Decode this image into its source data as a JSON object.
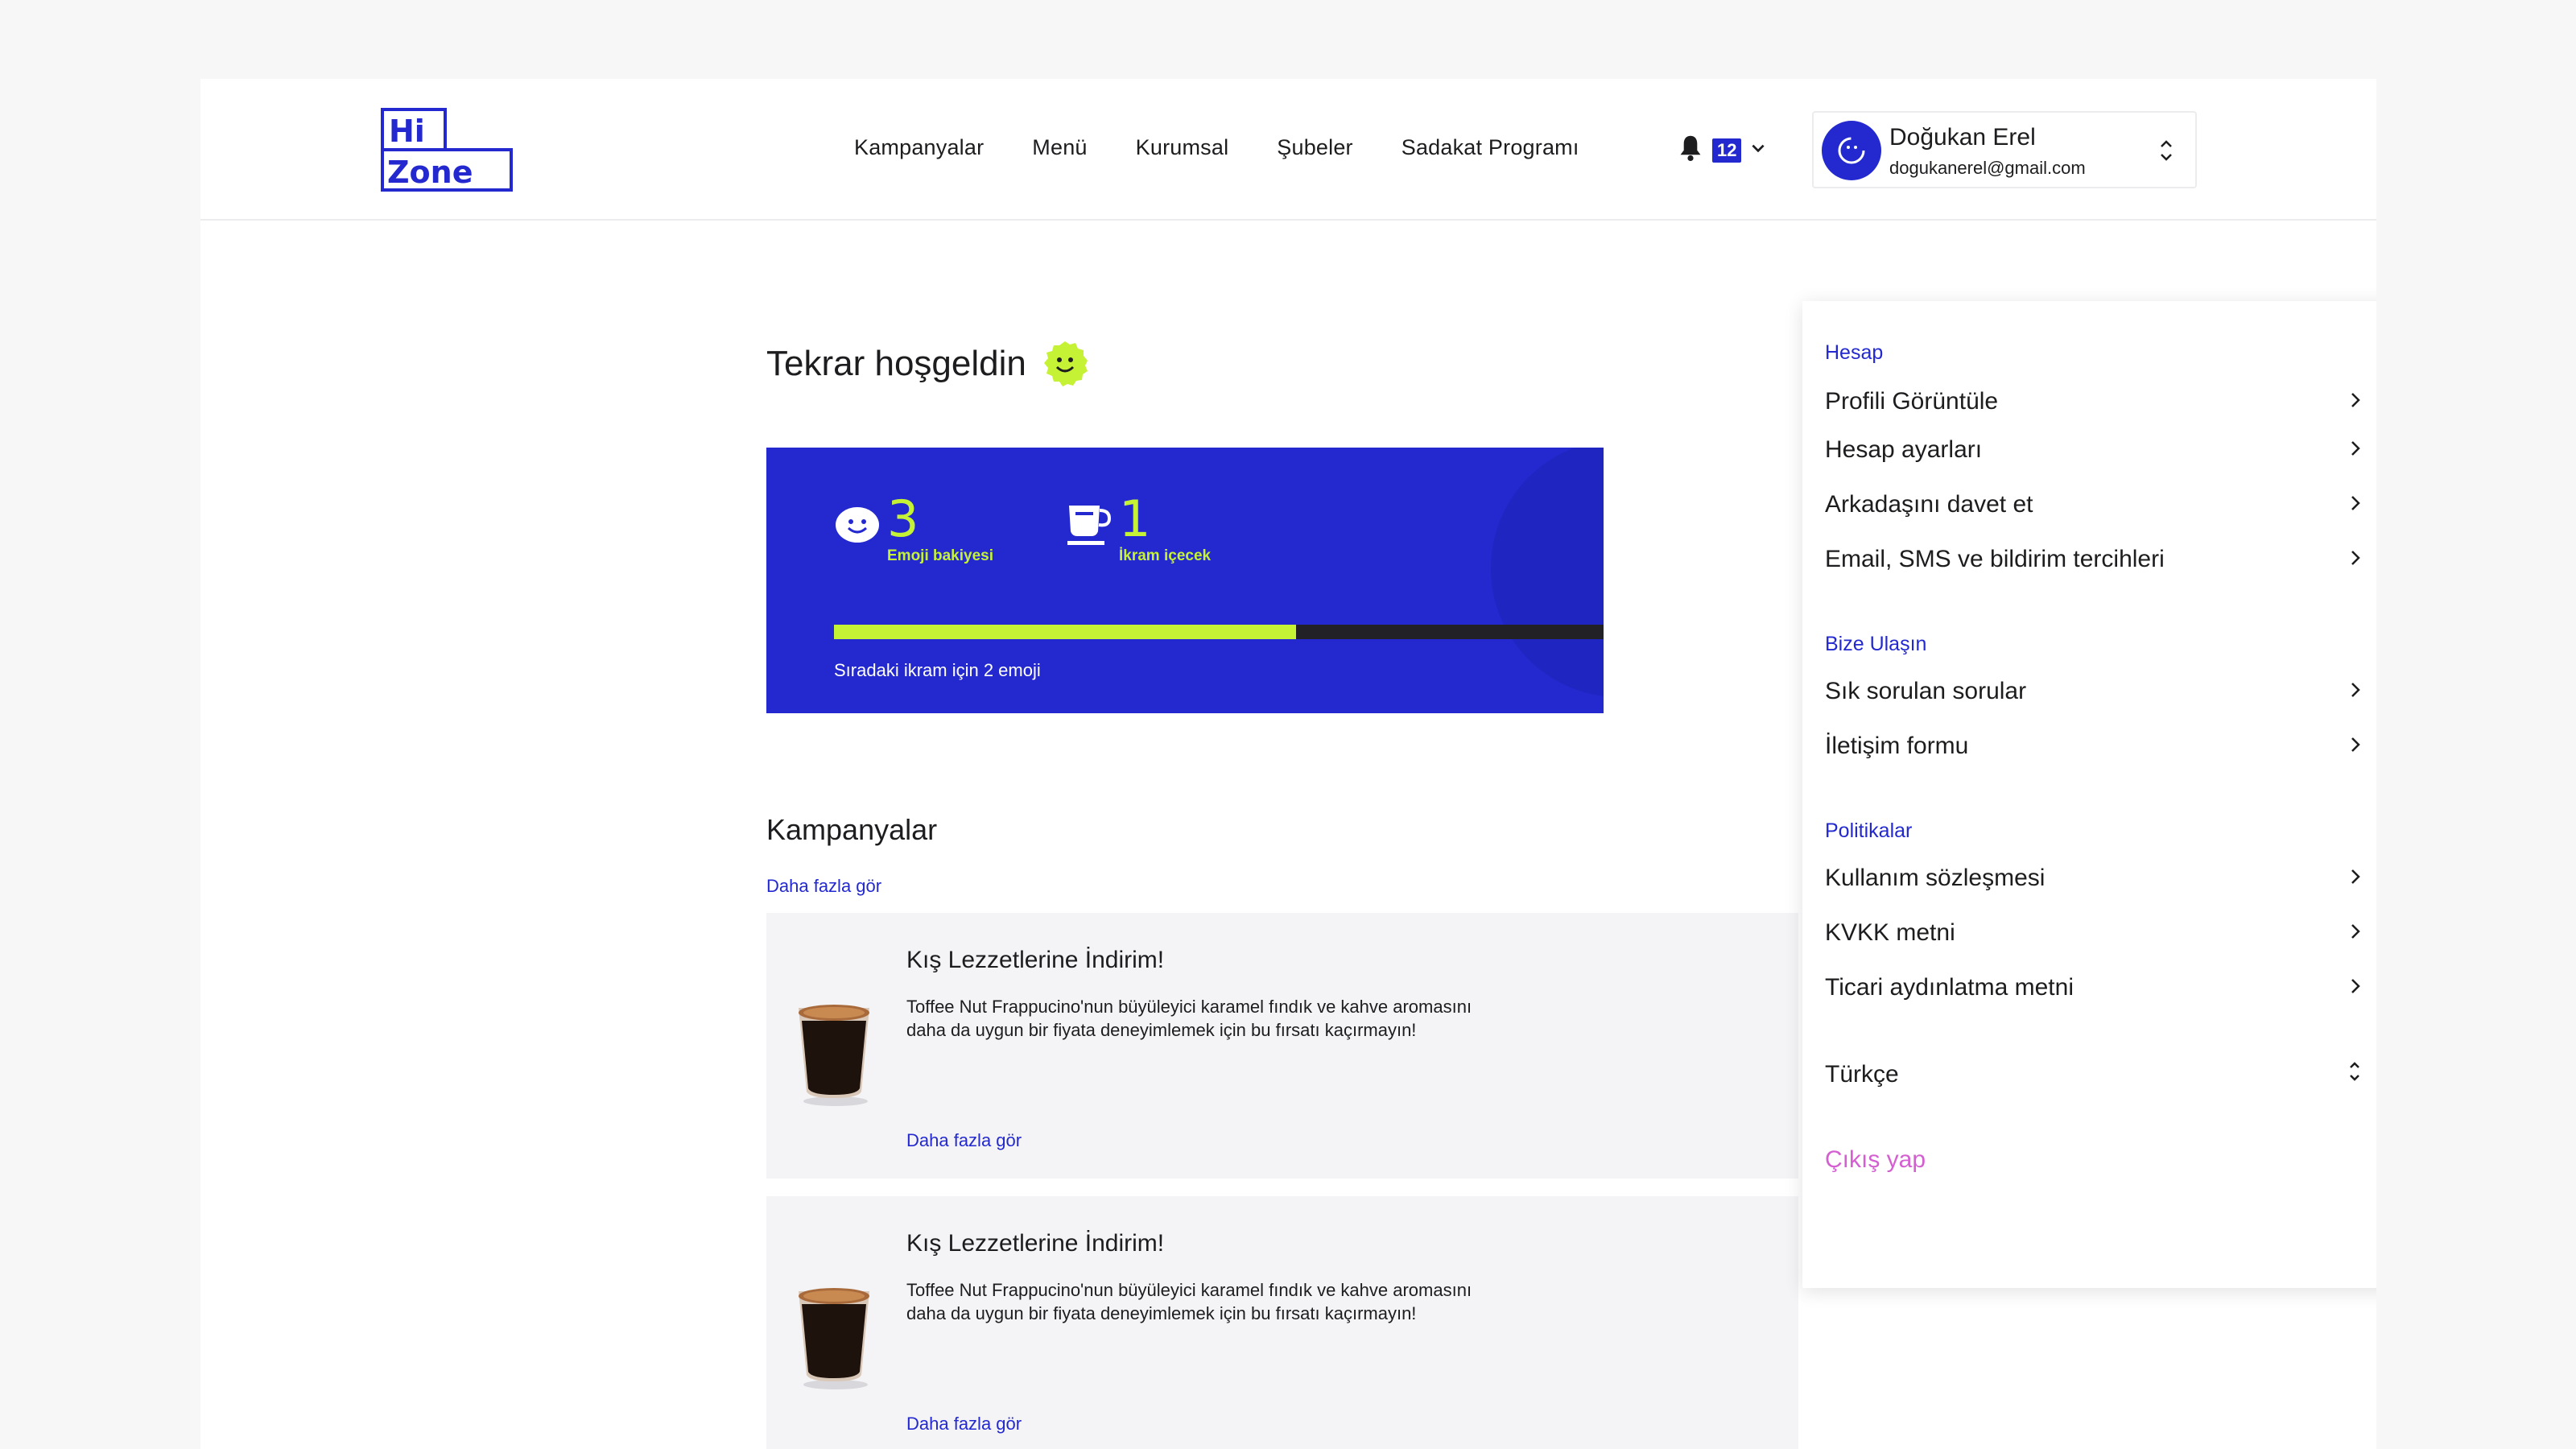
{
  "brand": {
    "logo_line1": "Hi",
    "logo_line2": "Zone",
    "primary_color": "#2329cf",
    "accent_color": "#c5f234"
  },
  "nav": {
    "items": [
      "Kampanyalar",
      "Menü",
      "Kurumsal",
      "Şubeler",
      "Sadakat Programı"
    ]
  },
  "notifications": {
    "icon": "bell-icon",
    "count": "12"
  },
  "user": {
    "name": "Doğukan Erel",
    "email": "dogukanerel@gmail.com"
  },
  "welcome": {
    "title": "Tekrar hoşgeldin"
  },
  "loyalty": {
    "emoji_balance": "3",
    "emoji_balance_label": "Emoji bakiyesi",
    "free_drinks": "1",
    "free_drinks_label": "İkram içecek",
    "progress_fraction": 0.6,
    "progress_text": "Sıradaki ikram için 2 emoji"
  },
  "campaigns": {
    "title": "Kampanyalar",
    "see_more": "Daha fazla gör",
    "items": [
      {
        "title": "Kış Lezzetlerine İndirim!",
        "desc_line1": "Toffee Nut Frappucino'nun büyüleyici karamel fındık ve kahve aromasını",
        "desc_line2": "daha da uygun bir fiyata deneyimlemek için bu fırsatı kaçırmayın!",
        "link": "Daha fazla gör"
      },
      {
        "title": "Kış Lezzetlerine İndirim!",
        "desc_line1": "Toffee Nut Frappucino'nun büyüleyici karamel fındık ve kahve aromasını",
        "desc_line2": "daha da uygun bir fiyata deneyimlemek için bu fırsatı kaçırmayın!",
        "link": "Daha fazla gör"
      }
    ]
  },
  "menu": {
    "account_header": "Hesap",
    "account_items": [
      "Profili Görüntüle",
      "Hesap ayarları",
      "Arkadaşını davet et",
      "Email, SMS ve bildirim tercihleri"
    ],
    "contact_header": "Bize Ulaşın",
    "contact_items": [
      "Sık sorulan sorular",
      "İletişim formu"
    ],
    "policies_header": "Politikalar",
    "policies_items": [
      "Kullanım sözleşmesi",
      "KVKK metni",
      "Ticari aydınlatma metni"
    ],
    "language": "Türkçe",
    "logout": "Çıkış yap"
  }
}
